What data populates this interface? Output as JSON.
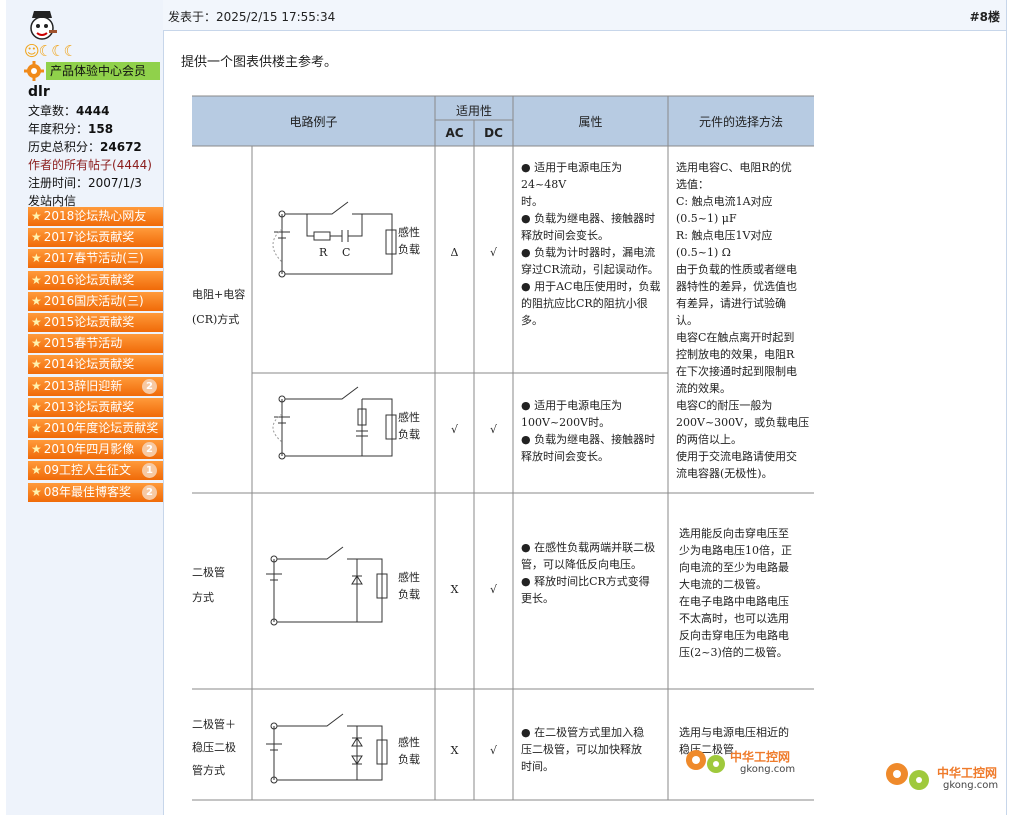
{
  "sidebar": {
    "user_group": "产品体验中心会员",
    "username": "dlr",
    "stats": [
      {
        "label": "文章数：",
        "value": "4444"
      },
      {
        "label": "年度积分：",
        "value": "158"
      },
      {
        "label": "历史总积分：",
        "value": "24672"
      }
    ],
    "all_posts": {
      "label": "作者的所有帖子",
      "count": "(4444)"
    },
    "register": {
      "label": "注册时间：",
      "value": "2007/1/3"
    },
    "message": "发站内信",
    "medals": [
      {
        "label": "2018论坛热心网友",
        "count": ""
      },
      {
        "label": "2017论坛贡献奖",
        "count": ""
      },
      {
        "label": "2017春节活动(三)",
        "count": ""
      },
      {
        "label": "2016论坛贡献奖",
        "count": ""
      },
      {
        "label": "2016国庆活动(三)",
        "count": ""
      },
      {
        "label": "2015论坛贡献奖",
        "count": ""
      },
      {
        "label": "2015春节活动",
        "count": ""
      },
      {
        "label": "2014论坛贡献奖",
        "count": ""
      },
      {
        "label": "2013辞旧迎新",
        "count": "2"
      },
      {
        "label": "2013论坛贡献奖",
        "count": ""
      },
      {
        "label": "2010年度论坛贡献奖",
        "count": ""
      },
      {
        "label": "2010年四月影像",
        "count": "2"
      },
      {
        "label": "09工控人生征文",
        "count": "1"
      },
      {
        "label": "08年最佳博客奖",
        "count": "2"
      }
    ]
  },
  "post": {
    "time": "发表于：2025/2/15 17:55:34",
    "floor": "#8楼",
    "text": "提供一个图表供楼主参考。"
  },
  "table": {
    "headers": {
      "example": "电路例子",
      "applicability": "适用性",
      "ac": "AC",
      "dc": "DC",
      "property": "属性",
      "selection": "元件的选择方法"
    },
    "rows": [
      {
        "name_lines": [
          "电阻+电容",
          "(CR)方式"
        ],
        "diagram_labels": [
          "感性",
          "负载",
          "R",
          "C"
        ],
        "ac": "Δ",
        "dc": "√",
        "property_lines": [
          "● 适用于电源电压为24~48V",
          "时。",
          "● 负载为继电器、接触器时",
          "释放时间会变长。",
          "● 负载为计时器时，漏电流",
          "穿过CR流动，引起误动作。",
          "● 用于AC电压使用时，负载",
          "的阻抗应比CR的阻抗小很",
          "多。"
        ]
      },
      {
        "name_lines": [],
        "diagram_labels": [
          "感性",
          "负载"
        ],
        "ac": "√",
        "dc": "√",
        "property_lines": [
          "● 适用于电源电压为",
          "100V~200V时。",
          "● 负载为继电器、接触器时",
          "释放时间会变长。"
        ]
      },
      {
        "name_lines": [
          "二极管",
          "方式"
        ],
        "diagram_labels": [
          "感性",
          "负载"
        ],
        "ac": "X",
        "dc": "√",
        "property_lines": [
          "● 在感性负载两端并联二极",
          "管，可以降低反向电压。",
          "● 释放时间比CR方式变得",
          "更长。"
        ],
        "selection_lines": [
          "选用能反向击穿电压至",
          "少为电路电压10倍，正",
          "向电流的至少为电路最",
          "大电流的二极管。",
          "在电子电路中电路电压",
          "不太高时，也可以选用",
          "反向击穿电压为电路电",
          "压(2~3)倍的二极管。"
        ]
      },
      {
        "name_lines": [
          "二极管＋",
          "稳压二极",
          "管方式"
        ],
        "diagram_labels": [
          "感性",
          "负载"
        ],
        "ac": "X",
        "dc": "√",
        "property_lines": [
          "● 在二极管方式里加入稳",
          "压二极管，可以加快释放",
          "时间。"
        ],
        "selection_lines": [
          "选用与电源电压相近的",
          "稳压二极管"
        ]
      }
    ],
    "cr_selection_lines": [
      "选用电容C、电阻R的优",
      "选值：",
      "C: 触点电流1A对应",
      "(0.5~1) μF",
      "R: 触点电压1V对应",
      "(0.5~1) Ω",
      "由于负载的性质或者继电",
      "器特性的差异，优选值也",
      "有差异，请进行试验确",
      "认。",
      "电容C在触点离开时起到",
      "控制放电的效果，电阻R",
      "在下次接通时起到限制电",
      "流的效果。",
      "电容C的耐压一般为",
      "200V~300V，或负载电压",
      "的两倍以上。",
      "使用于交流电路请使用交",
      "流电容器(无极性)。"
    ]
  },
  "watermark": {
    "name": "中华工控网",
    "url": "gkong.com"
  }
}
